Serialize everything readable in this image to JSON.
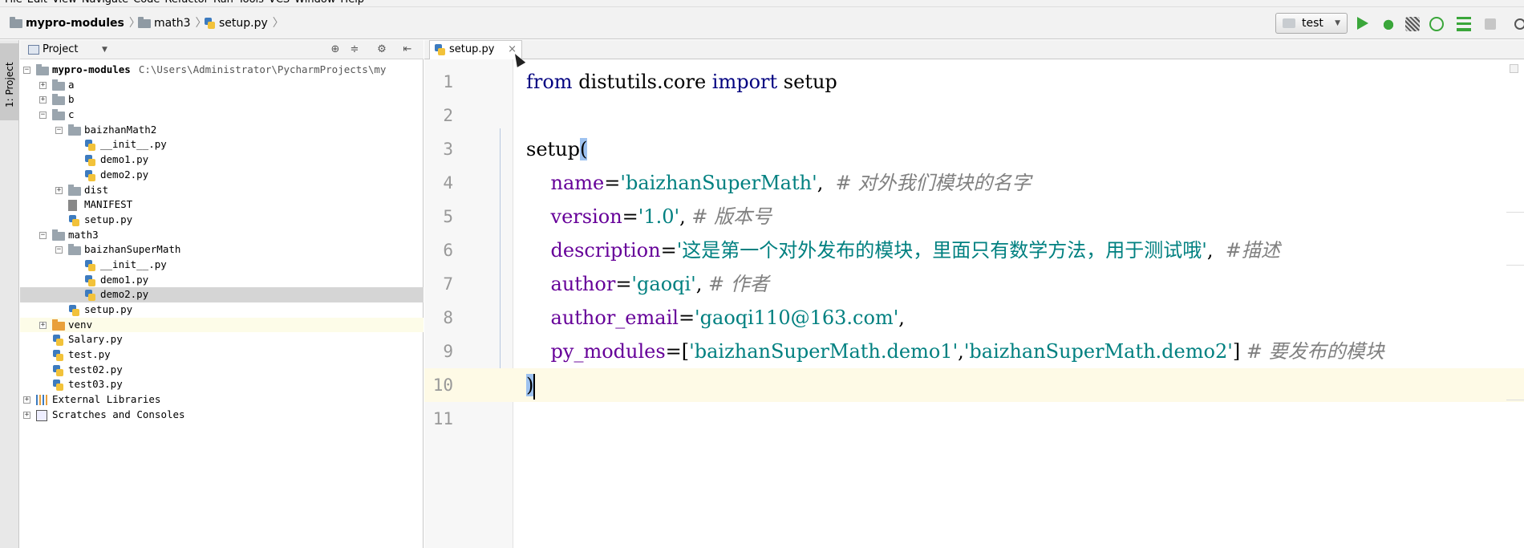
{
  "menu": [
    "File",
    "Edit",
    "View",
    "Navigate",
    "Code",
    "Refactor",
    "Run",
    "Tools",
    "VCS",
    "Window",
    "Help"
  ],
  "breadcrumb": [
    {
      "label": "mypro-modules",
      "icon": "folder-icon"
    },
    {
      "label": "math3",
      "icon": "folder-icon"
    },
    {
      "label": "setup.py",
      "icon": "python-file-icon"
    }
  ],
  "run_config": {
    "label": "test"
  },
  "side_strip": {
    "project_tab": "1: Project"
  },
  "project_panel": {
    "title": "Project",
    "root": {
      "label": "mypro-modules",
      "path": "C:\\Users\\Administrator\\PycharmProjects\\my"
    },
    "items": [
      {
        "label": "a",
        "type": "folder",
        "depth": 1,
        "toggle": "+"
      },
      {
        "label": "b",
        "type": "folder",
        "depth": 1,
        "toggle": "+"
      },
      {
        "label": "c",
        "type": "folder",
        "depth": 1,
        "toggle": "−"
      },
      {
        "label": "baizhanMath2",
        "type": "folder",
        "depth": 2,
        "toggle": "−"
      },
      {
        "label": "__init__.py",
        "type": "py",
        "depth": 3
      },
      {
        "label": "demo1.py",
        "type": "py",
        "depth": 3
      },
      {
        "label": "demo2.py",
        "type": "py",
        "depth": 3
      },
      {
        "label": "dist",
        "type": "folder",
        "depth": 2,
        "toggle": "+"
      },
      {
        "label": "MANIFEST",
        "type": "file",
        "depth": 2
      },
      {
        "label": "setup.py",
        "type": "py",
        "depth": 2
      },
      {
        "label": "math3",
        "type": "folder",
        "depth": 1,
        "toggle": "−"
      },
      {
        "label": "baizhanSuperMath",
        "type": "folder",
        "depth": 2,
        "toggle": "−"
      },
      {
        "label": "__init__.py",
        "type": "py",
        "depth": 3
      },
      {
        "label": "demo1.py",
        "type": "py",
        "depth": 3
      },
      {
        "label": "demo2.py",
        "type": "py",
        "depth": 3,
        "selected": true
      },
      {
        "label": "setup.py",
        "type": "py",
        "depth": 2
      },
      {
        "label": "venv",
        "type": "folder-orange",
        "depth": 1,
        "toggle": "+",
        "highlight": true
      },
      {
        "label": "Salary.py",
        "type": "py",
        "depth": 1
      },
      {
        "label": "test.py",
        "type": "py",
        "depth": 1
      },
      {
        "label": "test02.py",
        "type": "py",
        "depth": 1
      },
      {
        "label": "test03.py",
        "type": "py",
        "depth": 1
      },
      {
        "label": "External Libraries",
        "type": "libs",
        "depth": 0,
        "toggle": "+"
      },
      {
        "label": "Scratches and Consoles",
        "type": "scratch",
        "depth": 0,
        "toggle": "+"
      }
    ]
  },
  "editor": {
    "tab": {
      "label": "setup.py"
    },
    "lines": [
      {
        "n": "1",
        "tokens": [
          {
            "t": "from",
            "c": "kw"
          },
          {
            "t": " distutils.core ",
            "c": "id"
          },
          {
            "t": "import",
            "c": "kw"
          },
          {
            "t": " setup",
            "c": "id"
          }
        ]
      },
      {
        "n": "2",
        "tokens": []
      },
      {
        "n": "3",
        "tokens": [
          {
            "t": "setup",
            "c": "id"
          },
          {
            "t": "(",
            "c": "hlparen"
          }
        ]
      },
      {
        "n": "4",
        "tokens": [
          {
            "t": "    name",
            "c": "param"
          },
          {
            "t": "=",
            "c": "id"
          },
          {
            "t": "'baizhanSuperMath'",
            "c": "str"
          },
          {
            "t": ",  ",
            "c": "id"
          },
          {
            "t": "# 对外我们模块的名字",
            "c": "cmt"
          }
        ]
      },
      {
        "n": "5",
        "tokens": [
          {
            "t": "    version",
            "c": "param"
          },
          {
            "t": "=",
            "c": "id"
          },
          {
            "t": "'1.0'",
            "c": "str"
          },
          {
            "t": ", ",
            "c": "id"
          },
          {
            "t": "# 版本号",
            "c": "cmt"
          }
        ]
      },
      {
        "n": "6",
        "tokens": [
          {
            "t": "    description",
            "c": "param"
          },
          {
            "t": "=",
            "c": "id"
          },
          {
            "t": "'这是第一个对外发布的模块，里面只有数学方法，用于测试哦'",
            "c": "str"
          },
          {
            "t": ",  ",
            "c": "id"
          },
          {
            "t": "#描述",
            "c": "cmt"
          }
        ]
      },
      {
        "n": "7",
        "tokens": [
          {
            "t": "    author",
            "c": "param"
          },
          {
            "t": "=",
            "c": "id"
          },
          {
            "t": "'gaoqi'",
            "c": "str"
          },
          {
            "t": ", ",
            "c": "id"
          },
          {
            "t": "# 作者",
            "c": "cmt"
          }
        ]
      },
      {
        "n": "8",
        "tokens": [
          {
            "t": "    author_email",
            "c": "param"
          },
          {
            "t": "=",
            "c": "id"
          },
          {
            "t": "'gaoqi110@163.com'",
            "c": "str"
          },
          {
            "t": ",",
            "c": "id"
          }
        ]
      },
      {
        "n": "9",
        "tokens": [
          {
            "t": "    py_modules",
            "c": "param"
          },
          {
            "t": "=[",
            "c": "id"
          },
          {
            "t": "'baizhanSuperMath.demo1'",
            "c": "str"
          },
          {
            "t": ",",
            "c": "id"
          },
          {
            "t": "'baizhanSuperMath.demo2'",
            "c": "str"
          },
          {
            "t": "] ",
            "c": "id"
          },
          {
            "t": "# 要发布的模块",
            "c": "cmt"
          }
        ]
      },
      {
        "n": "10",
        "tokens": [
          {
            "t": ")",
            "c": "hlparen"
          }
        ],
        "current": true,
        "caret": true
      },
      {
        "n": "11",
        "tokens": []
      }
    ]
  }
}
